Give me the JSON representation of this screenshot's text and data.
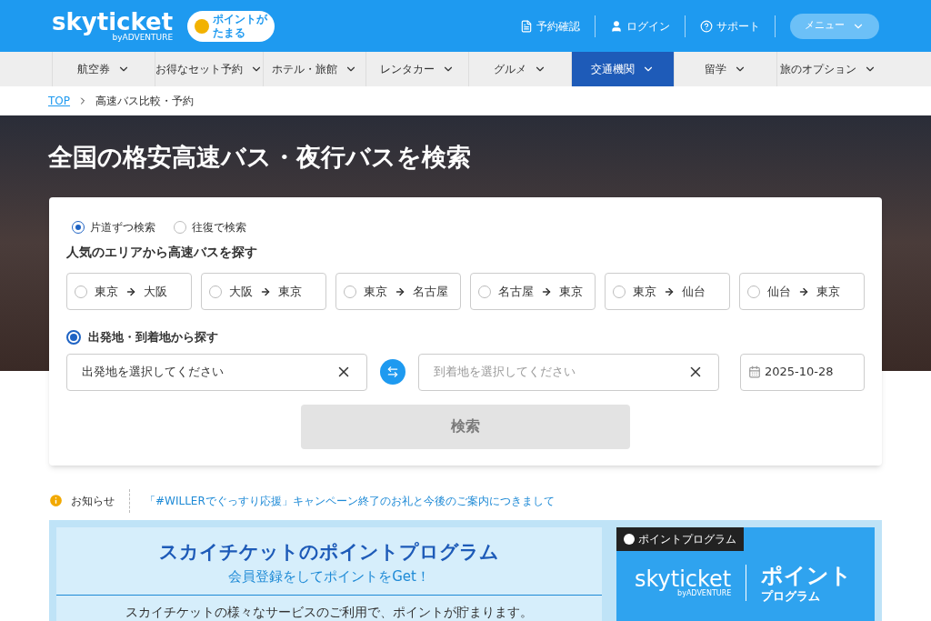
{
  "header": {
    "logo": "skyticket",
    "logo_sub": "byADVENTURE",
    "badge": [
      "ポイントが",
      "たまる"
    ],
    "links": [
      {
        "kind": "document",
        "label": "予約確認"
      },
      {
        "kind": "user",
        "label": "ログイン"
      },
      {
        "kind": "help",
        "label": "サポート"
      }
    ],
    "menu_button": "メニュー"
  },
  "nav": [
    {
      "label": "航空券",
      "selected": false
    },
    {
      "label": "お得なセット予約",
      "selected": false
    },
    {
      "label": "ホテル・旅館",
      "selected": false
    },
    {
      "label": "レンタカー",
      "selected": false
    },
    {
      "label": "グルメ",
      "selected": false
    },
    {
      "label": "交通機関",
      "selected": true
    },
    {
      "label": "留学",
      "selected": false
    },
    {
      "label": "旅のオプション",
      "selected": false
    }
  ],
  "breadcrumb": [
    {
      "kind": "link",
      "label": "TOP"
    },
    {
      "kind": "current",
      "label": "高速バス比較・予約"
    }
  ],
  "hero": {
    "title": "全国の格安高速バス・夜行バスを検索"
  },
  "search": {
    "trip_types": [
      {
        "label": "片道ずつ検索",
        "selected": true
      },
      {
        "label": "往復で検索",
        "selected": false
      }
    ],
    "popular_heading": "人気のエリアから高速バスを探す",
    "popular_routes": [
      {
        "from": "東京",
        "to": "大阪",
        "selected": false
      },
      {
        "from": "大阪",
        "to": "東京",
        "selected": false
      },
      {
        "from": "東京",
        "to": "名古屋",
        "selected": false
      },
      {
        "from": "名古屋",
        "to": "東京",
        "selected": false
      },
      {
        "from": "東京",
        "to": "仙台",
        "selected": false
      },
      {
        "from": "仙台",
        "to": "東京",
        "selected": false
      }
    ],
    "custom": {
      "label": "出発地・到着地から探す",
      "selected": true
    },
    "departure": {
      "value": "出発地を選択してください"
    },
    "arrival": {
      "placeholder": "到着地を選択してください"
    },
    "date": {
      "value": "2025-10-28"
    },
    "submit": {
      "label": "検索",
      "disabled": true
    }
  },
  "notice": {
    "label": "お知らせ",
    "link": "「#WILLERでぐっすり応援」キャンペーン終了のお礼と今後のご案内につきまして"
  },
  "points": {
    "title": "スカイチケットのポイントプログラム",
    "subtitle": "会員登録をしてポイントをGet！",
    "text": "スカイチケットの様々なサービスのご利用で、ポイントが貯まります。",
    "card": {
      "tag": "ポイントプログラム",
      "logo": "skyticket",
      "logo_sub": "byADVENTURE",
      "title": "ポイント",
      "title_sub": "プログラム"
    }
  }
}
